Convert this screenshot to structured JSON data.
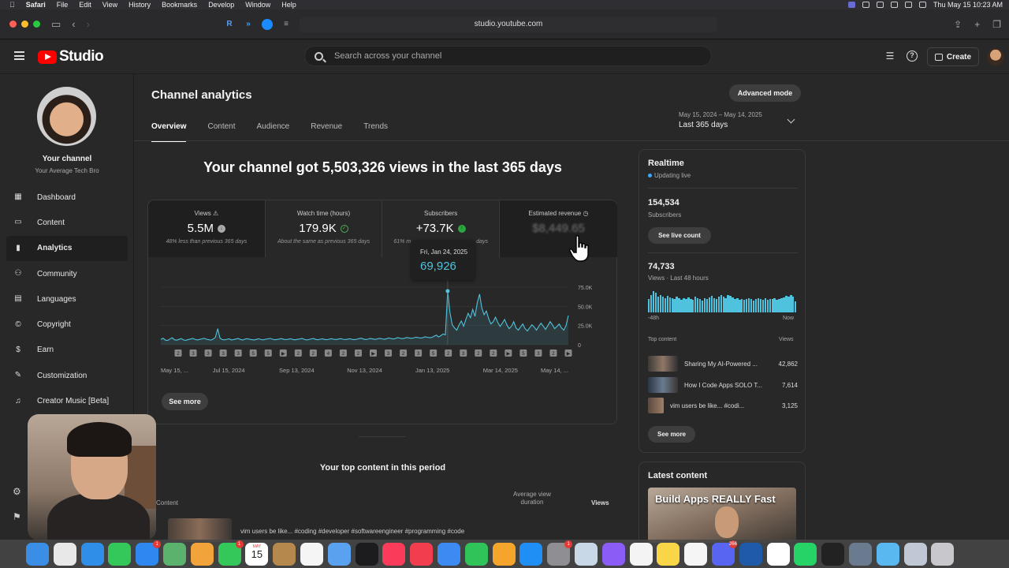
{
  "menubar": {
    "apple": "",
    "items": [
      "Safari",
      "File",
      "Edit",
      "View",
      "History",
      "Bookmarks",
      "Develop",
      "Window",
      "Help"
    ],
    "clock": "Thu May 15  10:23 AM"
  },
  "browser": {
    "url": "studio.youtube.com"
  },
  "header": {
    "logo_text": "Studio",
    "search_placeholder": "Search across your channel",
    "create_label": "Create",
    "icons": [
      "hamburger-icon",
      "search-icon",
      "captions-icon",
      "help-icon",
      "create-icon"
    ]
  },
  "sidebar": {
    "channel_title": "Your channel",
    "channel_name": "Your Average Tech Bro",
    "items": [
      {
        "label": "Dashboard",
        "icon": "dashboard-icon",
        "glyph": "▦",
        "active": false
      },
      {
        "label": "Content",
        "icon": "content-icon",
        "glyph": "▭",
        "active": false
      },
      {
        "label": "Analytics",
        "icon": "analytics-icon",
        "glyph": "▮",
        "active": true
      },
      {
        "label": "Community",
        "icon": "community-icon",
        "glyph": "⚇",
        "active": false
      },
      {
        "label": "Languages",
        "icon": "languages-icon",
        "glyph": "▤",
        "active": false
      },
      {
        "label": "Copyright",
        "icon": "copyright-icon",
        "glyph": "©",
        "active": false
      },
      {
        "label": "Earn",
        "icon": "earn-icon",
        "glyph": "$",
        "active": false
      },
      {
        "label": "Customization",
        "icon": "customization-icon",
        "glyph": "✎",
        "active": false
      },
      {
        "label": "Creator Music [Beta]",
        "icon": "creator-music-icon",
        "glyph": "♫",
        "active": false
      }
    ]
  },
  "page": {
    "title": "Channel analytics",
    "advanced_mode": "Advanced mode",
    "tabs": [
      {
        "label": "Overview",
        "active": true
      },
      {
        "label": "Content",
        "active": false
      },
      {
        "label": "Audience",
        "active": false
      },
      {
        "label": "Revenue",
        "active": false
      },
      {
        "label": "Trends",
        "active": false
      }
    ],
    "date_range_dates": "May 15, 2024 – May 14, 2025",
    "date_range_label": "Last 365 days",
    "headline": "Your channel got 5,503,326 views in the last 365 days"
  },
  "metrics": [
    {
      "label": "Views",
      "value": "5.5M",
      "note": "48% less than previous 365 days",
      "status": "down"
    },
    {
      "label": "Watch time (hours)",
      "value": "179.9K",
      "note": "About the same as previous 365 days",
      "status": "same"
    },
    {
      "label": "Subscribers",
      "value": "+73.7K",
      "note": "61% m",
      "note_tail": "days",
      "status": "up"
    },
    {
      "label": "Estimated revenue",
      "value": "$8,449.65",
      "status": "hidden"
    }
  ],
  "tooltip": {
    "date": "Fri, Jan 24, 2025",
    "value": "69,926"
  },
  "see_more_label": "See more",
  "chart_data": {
    "type": "line",
    "series": [
      {
        "values": [
          7000,
          8500,
          6000,
          5500,
          7500,
          9000,
          6500,
          6000,
          7000,
          8000,
          6200,
          5800,
          6800,
          7400,
          8200,
          7100,
          6300,
          6900,
          7600,
          8400,
          7200,
          6600,
          6100,
          7300,
          9800,
          21000,
          8600,
          6700,
          6400,
          7100,
          7700,
          6300,
          6800,
          7500,
          8100,
          6900,
          6200,
          7400,
          7900,
          7100,
          6600,
          6300,
          7000,
          7800,
          6800,
          6400,
          7200,
          7600,
          8300,
          7300,
          6500,
          6900,
          7400,
          8000,
          7000,
          6700,
          7300,
          7800,
          6900,
          6400,
          7100,
          7500,
          8200,
          7100,
          6300,
          6800,
          7600,
          8100,
          7000,
          6500,
          7200,
          7700,
          6900,
          6600,
          7300,
          7900,
          7100,
          6800,
          7400,
          8000,
          7200,
          6700,
          7300,
          7800,
          7000,
          6600,
          7200,
          7900,
          8500,
          7400,
          6800,
          7300,
          8100,
          7600,
          7000,
          7500,
          8300,
          7800,
          7100,
          7600,
          8700,
          8200,
          7500,
          8000,
          9200,
          8600,
          7900,
          8400,
          9500,
          8900,
          8300,
          8800,
          9900,
          9300,
          8600,
          9100,
          10400,
          9800,
          9100,
          9600,
          11000,
          12500,
          10200,
          11800,
          14000,
          12800,
          69926,
          42000,
          26000,
          22000,
          19000,
          26000,
          31000,
          24000,
          33000,
          41000,
          35000,
          46000,
          37000,
          55000,
          66000,
          48000,
          39000,
          44000,
          34000,
          27000,
          30000,
          36000,
          29000,
          24000,
          28000,
          33000,
          26000,
          21000,
          24000,
          30000,
          22000,
          19000,
          23000,
          27000,
          21000,
          18000,
          22000,
          26000,
          23000,
          19000,
          24000,
          28000,
          24000,
          20000,
          25000,
          30000,
          26000,
          21000,
          24000,
          27000,
          22000,
          19000,
          25000,
          38000
        ]
      }
    ],
    "x_tick_labels": [
      "May 15, ...",
      "Jul 15, 2024",
      "Sep 13, 2024",
      "Nov 13, 2024",
      "Jan 13, 2025",
      "Mar 14, 2025",
      "May 14, ..."
    ],
    "y_tick_labels": [
      "75.0K",
      "50.0K",
      "25.0K",
      "0"
    ],
    "ylim": [
      0,
      75000
    ],
    "color": "#4fc3dd",
    "grid": true,
    "video_markers": [
      "2",
      "3",
      "3",
      "3",
      "3",
      "5",
      "5",
      "▶",
      "2",
      "2",
      "4",
      "2",
      "2",
      "▶",
      "3",
      "2",
      "3",
      "5",
      "2",
      "3",
      "2",
      "2",
      "▶",
      "5",
      "3",
      "2",
      "▶"
    ]
  },
  "top_content": {
    "title": "Your top content in this period",
    "col_content": "Content",
    "col_avg": "Average view duration",
    "col_views": "Views",
    "first_row_title": "vim users be like... #coding #developer #softwareengineer #programming #code"
  },
  "realtime": {
    "title": "Realtime",
    "updating": "Updating live",
    "subscribers_value": "154,534",
    "subscribers_label": "Subscribers",
    "see_live_count": "See live count",
    "views_value": "74,733",
    "views_label": "Views · Last 48 hours",
    "bars": [
      0.62,
      0.78,
      0.95,
      0.88,
      0.72,
      0.8,
      0.7,
      0.66,
      0.74,
      0.69,
      0.63,
      0.6,
      0.71,
      0.66,
      0.58,
      0.64,
      0.6,
      0.67,
      0.62,
      0.58,
      0.7,
      0.65,
      0.61,
      0.55,
      0.63,
      0.59,
      0.68,
      0.75,
      0.64,
      0.6,
      0.7,
      0.78,
      0.72,
      0.66,
      0.8,
      0.74,
      0.68,
      0.6,
      0.66,
      0.58,
      0.62,
      0.57,
      0.6,
      0.64,
      0.59,
      0.55,
      0.61,
      0.66,
      0.6,
      0.56,
      0.63,
      0.58,
      0.62,
      0.6,
      0.65,
      0.57,
      0.61,
      0.64,
      0.69,
      0.75,
      0.7,
      0.8,
      0.72,
      0.5
    ],
    "axis_left": "-48h",
    "axis_right": "Now",
    "top_content_label": "Top content",
    "top_content_views_label": "Views",
    "top_items": [
      {
        "title": "Sharing My AI-Powered ...",
        "views": "42,862"
      },
      {
        "title": "How I Code Apps SOLO T...",
        "views": "7,614"
      },
      {
        "title": "vim users be like... #codi...",
        "views": "3,125"
      }
    ],
    "see_more": "See more"
  },
  "latest_content": {
    "title": "Latest content",
    "thumb_text": "Build Apps REALLY Fast"
  },
  "dock": {
    "calendar_month": "MAY",
    "calendar_day": "15",
    "apps": [
      {
        "name": "finder",
        "color": "#3b8ee6"
      },
      {
        "name": "launchpad",
        "color": "#e8e8e8"
      },
      {
        "name": "safari",
        "color": "#2f8fe8"
      },
      {
        "name": "messages",
        "color": "#34c759"
      },
      {
        "name": "mail",
        "color": "#2e88f0",
        "badge": "1"
      },
      {
        "name": "maps",
        "color": "#5bb26c"
      },
      {
        "name": "photos",
        "color": "#f2a33a"
      },
      {
        "name": "facetime",
        "color": "#34c759",
        "badge": "1"
      },
      {
        "name": "calendar",
        "color": "#ffffff"
      },
      {
        "name": "notes-brown",
        "color": "#b5884e"
      },
      {
        "name": "reminders",
        "color": "#f5f5f5"
      },
      {
        "name": "freeform",
        "color": "#5aa2f0"
      },
      {
        "name": "tv",
        "color": "#1c1c1e"
      },
      {
        "name": "music",
        "color": "#fa3c5a"
      },
      {
        "name": "news",
        "color": "#f23d4f"
      },
      {
        "name": "keynote",
        "color": "#3d8bf2"
      },
      {
        "name": "numbers",
        "color": "#30c35a"
      },
      {
        "name": "pages",
        "color": "#f6a52c"
      },
      {
        "name": "app-store",
        "color": "#1f8ff5"
      },
      {
        "name": "settings",
        "color": "#8e8e93",
        "badge": "1"
      },
      {
        "name": "preview",
        "color": "#c9d8e6"
      },
      {
        "name": "feedback",
        "color": "#8b5cf6"
      },
      {
        "name": "chrome",
        "color": "#f4f4f4"
      },
      {
        "name": "notes",
        "color": "#f9d548"
      },
      {
        "name": "slack",
        "color": "#f5f5f5"
      },
      {
        "name": "discord",
        "color": "#5865f2",
        "badge": "266"
      },
      {
        "name": "quicktime",
        "color": "#1e5aa8"
      },
      {
        "name": "notion",
        "color": "#ffffff"
      },
      {
        "name": "whatsapp",
        "color": "#25d366"
      },
      {
        "name": "unity",
        "color": "#222222"
      },
      {
        "name": "screen-share",
        "color": "#6a7b8f"
      },
      {
        "name": "xcode-sim",
        "color": "#5ab8f0"
      },
      {
        "name": "downloads",
        "color": "#bfc8d4"
      },
      {
        "name": "trash",
        "color": "#c7c7cc"
      }
    ]
  }
}
